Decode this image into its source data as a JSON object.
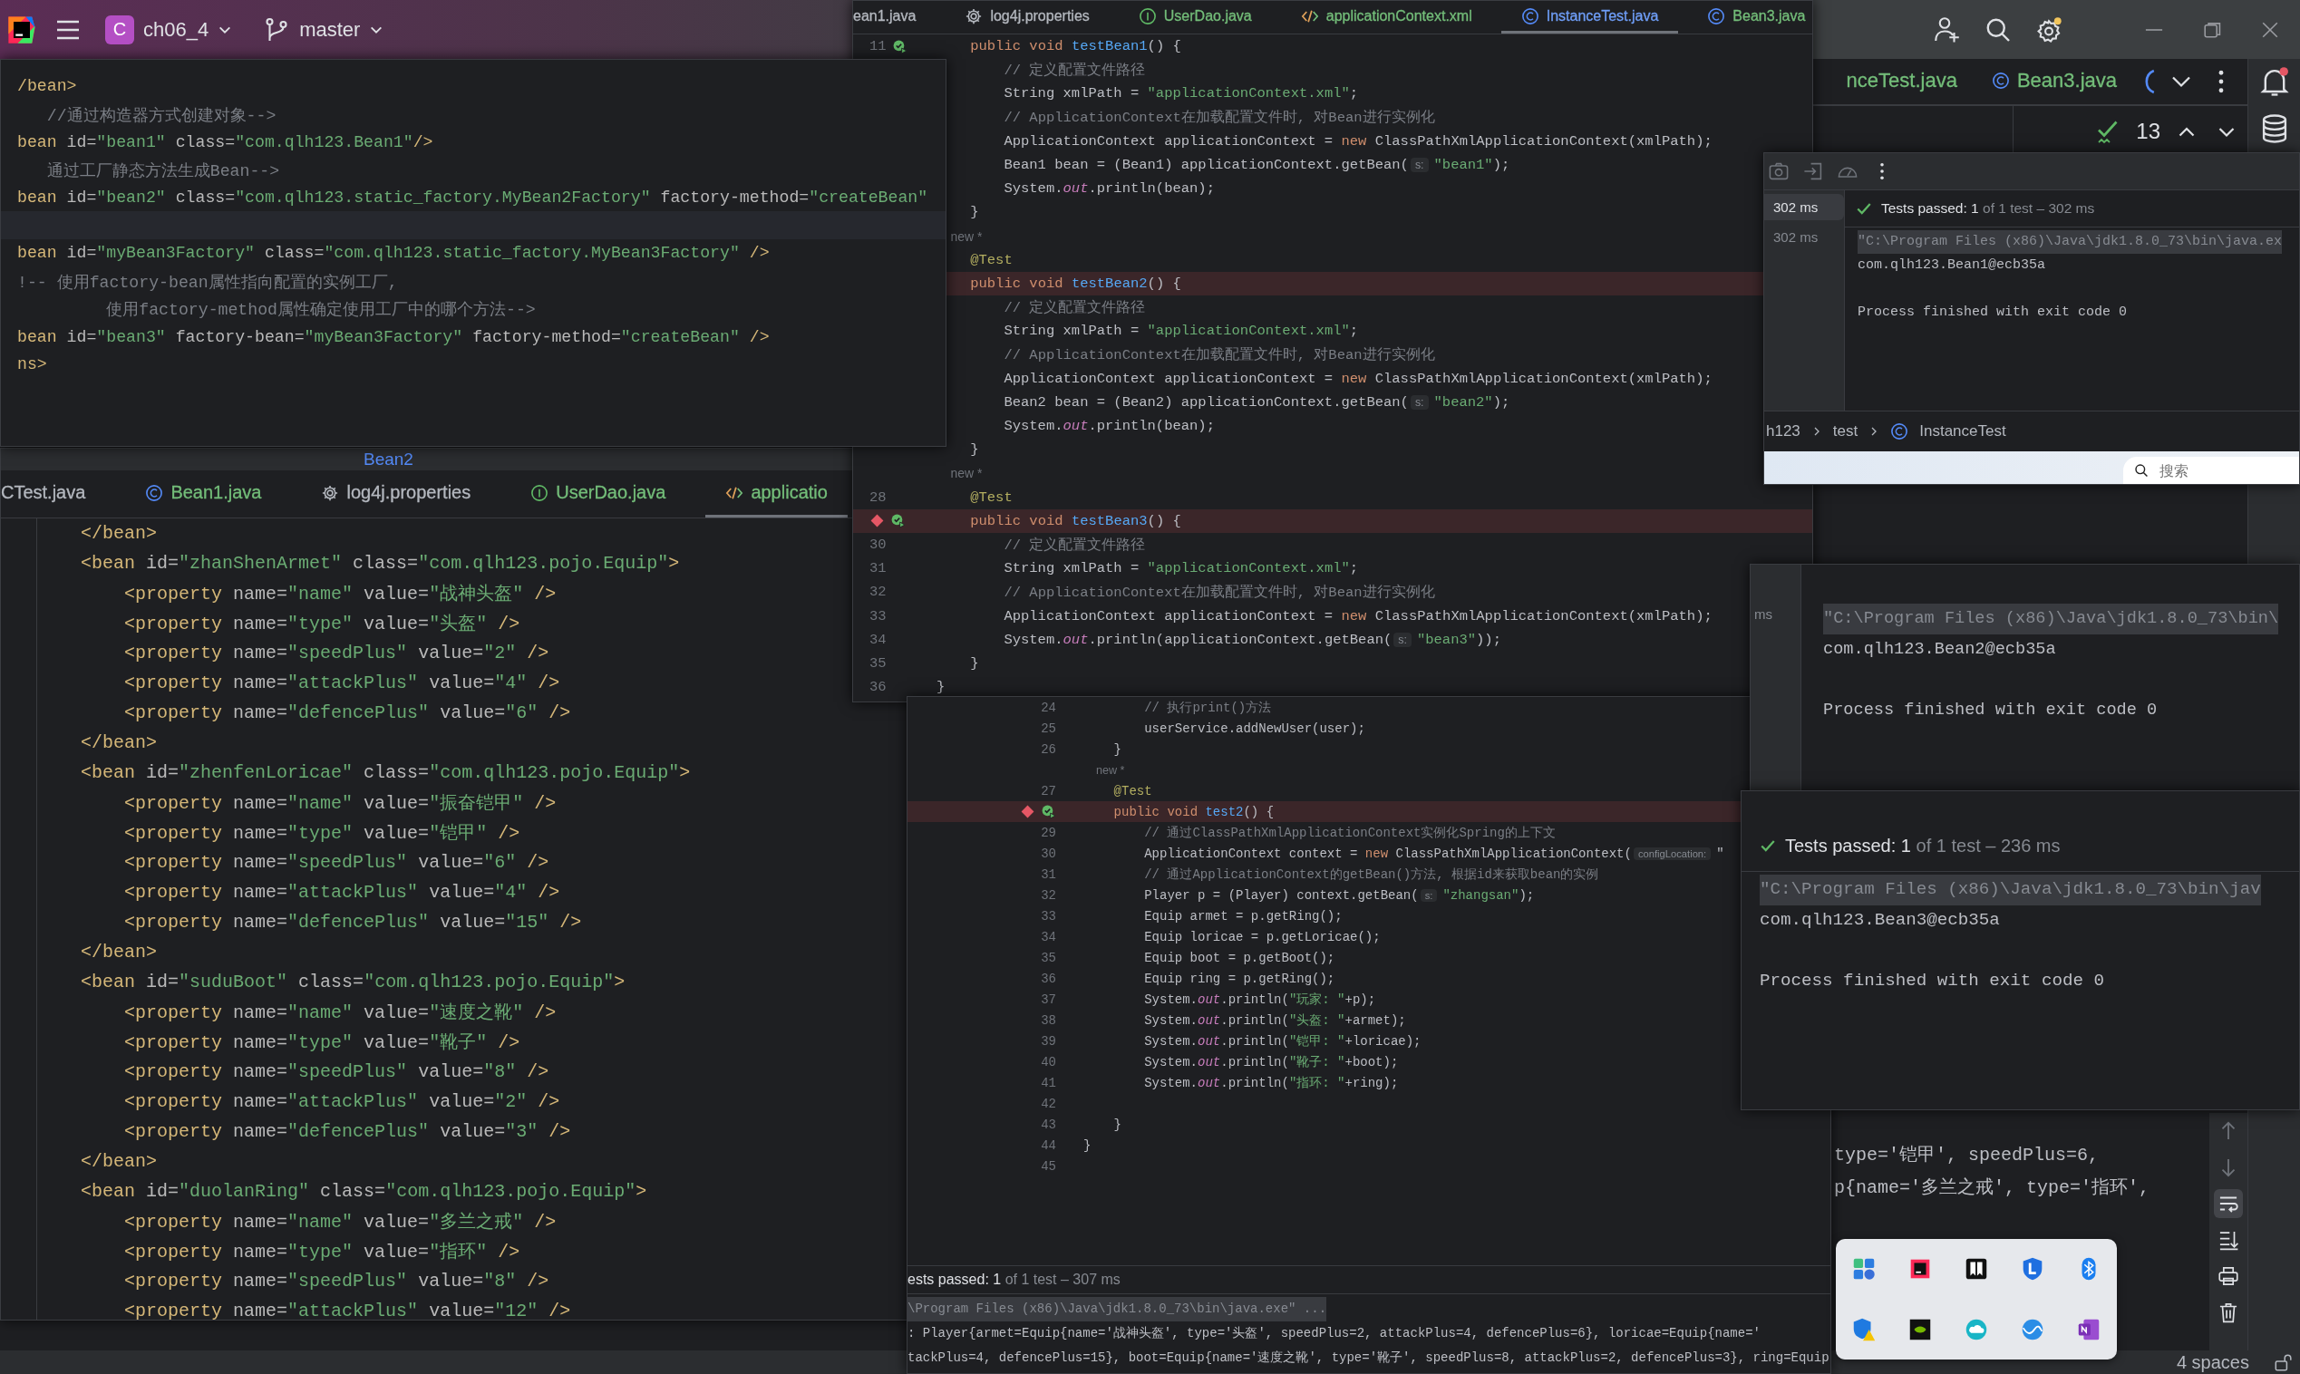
{
  "ide": {
    "project": {
      "initial": "C",
      "name": "ch06_4"
    },
    "branch": "master",
    "tabs": [
      {
        "label": "nceTest.java",
        "kind": "none",
        "color": "#73bd79",
        "selected": false
      },
      {
        "label": "Bean3.java",
        "kind": "class",
        "color": "#73bd79",
        "selected": false
      }
    ],
    "problems_count": "13",
    "console_lines": [
      "type='铠甲', speedPlus=6,",
      "p{name='多兰之戒', type='指环',"
    ],
    "status_items": [
      "4 spaces"
    ]
  },
  "windows": [
    {
      "kind": "xml",
      "peek_tab": "Bean2",
      "tabs": [
        {
          "label": "CTest.java",
          "kind": "none",
          "color": "#b4b8bf",
          "selected": false
        },
        {
          "label": "Bean1.java",
          "kind": "class",
          "color": "#73bd79",
          "selected": false
        },
        {
          "label": "log4j.properties",
          "kind": "properties",
          "color": "#b4b8bf",
          "selected": false
        },
        {
          "label": "UserDao.java",
          "kind": "interface",
          "color": "#73bd79",
          "selected": false
        },
        {
          "label": "applicatio",
          "kind": "xml",
          "color": "#73bd79",
          "selected": true
        }
      ],
      "lines": [
        {
          "kind": "code",
          "highlighted": false,
          "text": "    </bean>"
        },
        {
          "kind": "code",
          "highlighted": false,
          "text": "    <bean id=\"zhanShenArmet\" class=\"com.qlh123.pojo.Equip\">"
        },
        {
          "kind": "code",
          "highlighted": false,
          "text": "        <property name=\"name\" value=\"战神头盔\" />"
        },
        {
          "kind": "code",
          "highlighted": false,
          "text": "        <property name=\"type\" value=\"头盔\" />"
        },
        {
          "kind": "code",
          "highlighted": false,
          "text": "        <property name=\"speedPlus\" value=\"2\" />"
        },
        {
          "kind": "code",
          "highlighted": false,
          "text": "        <property name=\"attackPlus\" value=\"4\" />"
        },
        {
          "kind": "code",
          "highlighted": false,
          "text": "        <property name=\"defencePlus\" value=\"6\" />"
        },
        {
          "kind": "code",
          "highlighted": false,
          "text": "    </bean>"
        },
        {
          "kind": "code",
          "highlighted": false,
          "text": "    <bean id=\"zhenfenLoricae\" class=\"com.qlh123.pojo.Equip\">"
        },
        {
          "kind": "code",
          "highlighted": false,
          "text": "        <property name=\"name\" value=\"振奋铠甲\" />"
        },
        {
          "kind": "code",
          "highlighted": false,
          "text": "        <property name=\"type\" value=\"铠甲\" />"
        },
        {
          "kind": "code",
          "highlighted": false,
          "text": "        <property name=\"speedPlus\" value=\"6\" />"
        },
        {
          "kind": "code",
          "highlighted": false,
          "text": "        <property name=\"attackPlus\" value=\"4\" />"
        },
        {
          "kind": "code",
          "highlighted": false,
          "text": "        <property name=\"defencePlus\" value=\"15\" />"
        },
        {
          "kind": "code",
          "highlighted": false,
          "text": "    </bean>"
        },
        {
          "kind": "code",
          "highlighted": false,
          "text": "    <bean id=\"suduBoot\" class=\"com.qlh123.pojo.Equip\">"
        },
        {
          "kind": "code",
          "highlighted": false,
          "text": "        <property name=\"name\" value=\"速度之靴\" />"
        },
        {
          "kind": "code",
          "highlighted": false,
          "text": "        <property name=\"type\" value=\"靴子\" />"
        },
        {
          "kind": "code",
          "highlighted": false,
          "text": "        <property name=\"speedPlus\" value=\"8\" />"
        },
        {
          "kind": "code",
          "highlighted": false,
          "text": "        <property name=\"attackPlus\" value=\"2\" />"
        },
        {
          "kind": "code",
          "highlighted": false,
          "text": "        <property name=\"defencePlus\" value=\"3\" />"
        },
        {
          "kind": "code",
          "highlighted": false,
          "text": "    </bean>"
        },
        {
          "kind": "code",
          "highlighted": false,
          "text": "    <bean id=\"duolanRing\" class=\"com.qlh123.pojo.Equip\">"
        },
        {
          "kind": "code",
          "highlighted": false,
          "text": "        <property name=\"name\" value=\"多兰之戒\" />"
        },
        {
          "kind": "code",
          "highlighted": false,
          "text": "        <property name=\"type\" value=\"指环\" />"
        },
        {
          "kind": "code",
          "highlighted": false,
          "text": "        <property name=\"speedPlus\" value=\"8\" />"
        },
        {
          "kind": "code",
          "highlighted": false,
          "text": "        <property name=\"attackPlus\" value=\"12\" />"
        }
      ]
    },
    {
      "kind": "java",
      "tabs": [
        {
          "label": "ean1.java",
          "kind": "none",
          "color": "#b4b8bf",
          "selected": false
        },
        {
          "label": "log4j.properties",
          "kind": "properties",
          "color": "#b4b8bf",
          "selected": false
        },
        {
          "label": "UserDao.java",
          "kind": "interface",
          "color": "#73bd79",
          "selected": false
        },
        {
          "label": "applicationContext.xml",
          "kind": "xml",
          "color": "#73bd79",
          "selected": false
        },
        {
          "label": "InstanceTest.java",
          "kind": "class",
          "color": "#6f9ef8",
          "selected": true
        },
        {
          "label": "Bean3.java",
          "kind": "class",
          "color": "#73bd79",
          "selected": false
        }
      ],
      "lines": [
        {
          "kind": "runnable",
          "number": "11",
          "highlighted": false,
          "text": "    public void testBean1() {"
        },
        {
          "kind": "code",
          "highlighted": false,
          "text": "        // 定义配置文件路径"
        },
        {
          "kind": "code",
          "highlighted": false,
          "text": "        String xmlPath = \"applicationContext.xml\";"
        },
        {
          "kind": "code",
          "highlighted": false,
          "text": "        // ApplicationContext在加载配置文件时, 对Bean进行实例化"
        },
        {
          "kind": "code",
          "highlighted": false,
          "text": "        ApplicationContext applicationContext = new ClassPathXmlApplicationContext(xmlPath);"
        },
        {
          "kind": "code",
          "highlighted": false,
          "text": "        Bean1 bean = (Bean1) applicationContext.getBean(",
          "hint": "s:",
          "rest": "\"bean1\");"
        },
        {
          "kind": "code",
          "highlighted": false,
          "text": "        System.out.println(bean);"
        },
        {
          "kind": "code",
          "highlighted": false,
          "text": "    }"
        },
        {
          "kind": "author",
          "highlighted": false,
          "text": "    new *"
        },
        {
          "kind": "code",
          "highlighted": false,
          "text": "    @Test"
        },
        {
          "kind": "code",
          "highlighted": true,
          "text": "    public void testBean2() {"
        },
        {
          "kind": "code",
          "highlighted": false,
          "text": "        // 定义配置文件路径"
        },
        {
          "kind": "code",
          "highlighted": false,
          "text": "        String xmlPath = \"applicationContext.xml\";"
        },
        {
          "kind": "code",
          "highlighted": false,
          "text": "        // ApplicationContext在加载配置文件时, 对Bean进行实例化"
        },
        {
          "kind": "code",
          "highlighted": false,
          "text": "        ApplicationContext applicationContext = new ClassPathXmlApplicationContext(xmlPath);"
        },
        {
          "kind": "code",
          "highlighted": false,
          "text": "        Bean2 bean = (Bean2) applicationContext.getBean(",
          "hint": "s:",
          "rest": "\"bean2\");"
        },
        {
          "kind": "code",
          "highlighted": false,
          "text": "        System.out.println(bean);"
        },
        {
          "kind": "code",
          "highlighted": false,
          "text": "    }"
        },
        {
          "kind": "author",
          "highlighted": false,
          "text": "    new *"
        },
        {
          "kind": "code",
          "number": "28",
          "highlighted": false,
          "text": "    @Test"
        },
        {
          "kind": "breakpoint",
          "highlighted": true,
          "text": "    public void testBean3() {"
        },
        {
          "kind": "code",
          "number": "30",
          "highlighted": false,
          "text": "        // 定义配置文件路径"
        },
        {
          "kind": "code",
          "number": "31",
          "highlighted": false,
          "text": "        String xmlPath = \"applicationContext.xml\";"
        },
        {
          "kind": "code",
          "number": "32",
          "highlighted": false,
          "text": "        // ApplicationContext在加载配置文件时, 对Bean进行实例化"
        },
        {
          "kind": "code",
          "number": "33",
          "highlighted": false,
          "text": "        ApplicationContext applicationContext = new ClassPathXmlApplicationContext(xmlPath);"
        },
        {
          "kind": "code",
          "number": "34",
          "highlighted": false,
          "text": "        System.out.println(applicationContext.getBean(",
          "hint": "s:",
          "rest": "\"bean3\"));"
        },
        {
          "kind": "code",
          "number": "35",
          "highlighted": false,
          "text": "    }"
        },
        {
          "kind": "code",
          "number": "36",
          "highlighted": false,
          "text": "}"
        }
      ]
    },
    {
      "kind": "xml",
      "lines": [
        {
          "kind": "code",
          "highlighted": false,
          "text": "/bean>"
        },
        {
          "kind": "code",
          "highlighted": false,
          "text": "   //通过构造器方式创建对象-->"
        },
        {
          "kind": "code",
          "highlighted": false,
          "text": "bean id=\"bean1\" class=\"com.qlh123.Bean1\"/>"
        },
        {
          "kind": "code",
          "highlighted": false,
          "text": "   通过工厂静态方法生成Bean-->"
        },
        {
          "kind": "code",
          "highlighted": false,
          "text": "bean id=\"bean2\" class=\"com.qlh123.static_factory.MyBean2Factory\" factory-method=\"createBean\""
        },
        {
          "kind": "blank",
          "highlighted": true
        },
        {
          "kind": "code",
          "highlighted": false,
          "text": "bean id=\"myBean3Factory\" class=\"com.qlh123.static_factory.MyBean3Factory\" />"
        },
        {
          "kind": "code",
          "highlighted": false,
          "text": "!-- 使用factory-bean属性指向配置的实例工厂,"
        },
        {
          "kind": "code",
          "highlighted": false,
          "text": "         使用factory-method属性确定使用工厂中的哪个方法-->"
        },
        {
          "kind": "code",
          "highlighted": false,
          "text": "bean id=\"bean3\" factory-bean=\"myBean3Factory\" factory-method=\"createBean\" />"
        },
        {
          "kind": "code",
          "highlighted": false,
          "text": "ns>"
        }
      ]
    },
    {
      "kind": "java",
      "lines": [
        {
          "kind": "code",
          "number": "24",
          "highlighted": false,
          "text": "        // 执行print()方法"
        },
        {
          "kind": "code",
          "number": "25",
          "highlighted": false,
          "text": "        userService.addNewUser(user);"
        },
        {
          "kind": "code",
          "number": "26",
          "highlighted": false,
          "text": "    }"
        },
        {
          "kind": "author",
          "highlighted": false,
          "text": "    new *"
        },
        {
          "kind": "code",
          "number": "27",
          "highlighted": false,
          "text": "    @Test"
        },
        {
          "kind": "breakpoint",
          "highlighted": true,
          "text": "    public void test2() {"
        },
        {
          "kind": "code",
          "number": "29",
          "highlighted": false,
          "text": "        // 通过ClassPathXmlApplicationContext实例化Spring的上下文"
        },
        {
          "kind": "code",
          "number": "30",
          "highlighted": false,
          "text": "        ApplicationContext context = new ClassPathXmlApplicationContext(",
          "hint": "configLocation:",
          "rest": "\""
        },
        {
          "kind": "code",
          "number": "31",
          "highlighted": false,
          "text": "        // 通过ApplicationContext的getBean()方法, 根据id来获取bean的实例"
        },
        {
          "kind": "code",
          "number": "32",
          "highlighted": false,
          "text": "        Player p = (Player) context.getBean(",
          "hint": "s:",
          "rest": "\"zhangsan\");"
        },
        {
          "kind": "code",
          "number": "33",
          "highlighted": false,
          "text": "        Equip armet = p.getRing();"
        },
        {
          "kind": "code",
          "number": "34",
          "highlighted": false,
          "text": "        Equip loricae = p.getLoricae();"
        },
        {
          "kind": "code",
          "number": "35",
          "highlighted": false,
          "text": "        Equip boot = p.getBoot();"
        },
        {
          "kind": "code",
          "number": "36",
          "highlighted": false,
          "text": "        Equip ring = p.getRing();"
        },
        {
          "kind": "code",
          "number": "37",
          "highlighted": false,
          "text": "        System.out.println(\"玩家: \"+p);"
        },
        {
          "kind": "code",
          "number": "38",
          "highlighted": false,
          "text": "        System.out.println(\"头盔: \"+armet);"
        },
        {
          "kind": "code",
          "number": "39",
          "highlighted": false,
          "text": "        System.out.println(\"铠甲: \"+loricae);"
        },
        {
          "kind": "code",
          "number": "40",
          "highlighted": false,
          "text": "        System.out.println(\"靴子: \"+boot);"
        },
        {
          "kind": "code",
          "number": "41",
          "highlighted": false,
          "text": "        System.out.println(\"指环: \"+ring);"
        },
        {
          "kind": "blank",
          "number": "42",
          "highlighted": false
        },
        {
          "kind": "code",
          "number": "43",
          "highlighted": false,
          "text": "    }"
        },
        {
          "kind": "code",
          "number": "44",
          "highlighted": false,
          "text": "}"
        },
        {
          "kind": "blank",
          "number": "45",
          "highlighted": false
        }
      ],
      "run": {
        "summary": "ests passed: 1",
        "detail": "of 1 test – 307 ms",
        "console": [
          {
            "kind": "command",
            "text": "\\Program Files (x86)\\Java\\jdk1.8.0_73\\bin\\java.exe\" ..."
          },
          {
            "kind": "output",
            "text": ": Player{armet=Equip{name='战神头盔', type='头盔', speedPlus=2, attackPlus=4, defencePlus=6}, loricae=Equip{name='"
          },
          {
            "kind": "output",
            "text": "tackPlus=4, defencePlus=15}, boot=Equip{name='速度之靴', type='靴子', speedPlus=8, attackPlus=2, defencePlus=3}, ring=Equip"
          }
        ]
      }
    },
    {
      "kind": "run",
      "toolbar": true,
      "history": [
        {
          "label": "302 ms",
          "selected": true
        },
        {
          "label": "302 ms",
          "selected": false
        }
      ],
      "summary": "Tests passed: 1",
      "detail": "of 1 test – 302 ms",
      "console": [
        {
          "kind": "command",
          "text": "\"C:\\Program Files (x86)\\Java\\jdk1.8.0_73\\bin\\java.ex"
        },
        {
          "kind": "output",
          "text": "com.qlh123.Bean1@ecb35a"
        },
        {
          "kind": "blank"
        },
        {
          "kind": "output",
          "text": "Process finished with exit code 0"
        }
      ],
      "breadcrumb": [
        "h123",
        "test",
        "InstanceTest"
      ],
      "taskbar": {
        "search_placeholder": "搜索"
      }
    },
    {
      "kind": "run",
      "history": [
        {
          "label": "ms",
          "selected": false
        }
      ],
      "console": [
        {
          "kind": "command",
          "text": "\"C:\\Program Files (x86)\\Java\\jdk1.8.0_73\\bin\\"
        },
        {
          "kind": "output",
          "text": "com.qlh123.Bean2@ecb35a"
        },
        {
          "kind": "blank"
        },
        {
          "kind": "output",
          "text": "Process finished with exit code 0"
        }
      ]
    },
    {
      "kind": "run",
      "summary": "Tests passed: 1",
      "detail": "of 1 test – 236 ms",
      "console": [
        {
          "kind": "command",
          "text": "\"C:\\Program Files (x86)\\Java\\jdk1.8.0_73\\bin\\jav"
        },
        {
          "kind": "output",
          "text": "com.qlh123.Bean3@ecb35a"
        },
        {
          "kind": "blank"
        },
        {
          "kind": "output",
          "text": "Process finished with exit code 0"
        }
      ]
    }
  ]
}
